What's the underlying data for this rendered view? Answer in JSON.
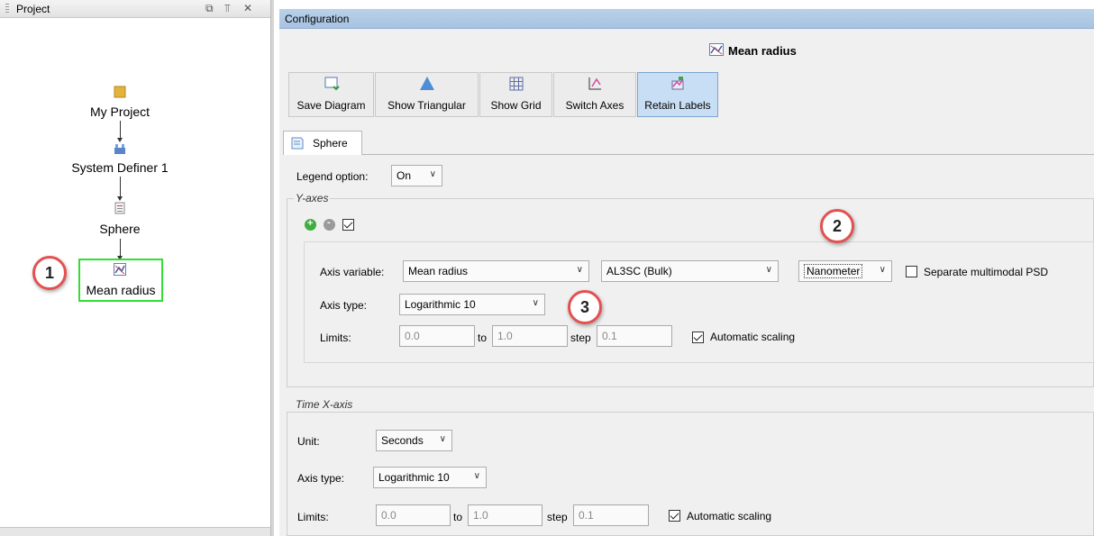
{
  "project": {
    "title": "Project",
    "nodes": [
      {
        "label": "My Project",
        "icon": "folder-icon"
      },
      {
        "label": "System Definer 1",
        "icon": "system-definer-icon"
      },
      {
        "label": "Sphere",
        "icon": "sphere-icon"
      },
      {
        "label": "Mean radius",
        "icon": "chart-icon"
      }
    ]
  },
  "badges": {
    "one": "1",
    "two": "2",
    "three": "3"
  },
  "configuration": {
    "title": "Configuration",
    "diagram_title": "Mean radius",
    "toolbar": [
      {
        "label": "Save Diagram",
        "icon": "save-diagram-icon"
      },
      {
        "label": "Show Triangular",
        "icon": "triangle-icon"
      },
      {
        "label": "Show Grid",
        "icon": "grid-icon"
      },
      {
        "label": "Switch Axes",
        "icon": "switch-axes-icon"
      },
      {
        "label": "Retain Labels",
        "icon": "retain-labels-icon"
      }
    ],
    "tab": "Sphere",
    "legend": {
      "label": "Legend option:",
      "value": "On"
    },
    "y_axes": {
      "title": "Y-axes",
      "axis_variable_label": "Axis variable:",
      "axis_variable": "Mean radius",
      "source": "AL3SC (Bulk)",
      "unit": "Nanometer",
      "separate_label": "Separate multimodal PSD",
      "axis_type_label": "Axis type:",
      "axis_type": "Logarithmic 10",
      "limits_label": "Limits:",
      "limit_from": "0.0",
      "to_label": "to",
      "limit_to": "1.0",
      "step_label": "step",
      "step": "0.1",
      "auto_scaling_label": "Automatic scaling"
    },
    "time_x_axis": {
      "title": "Time X-axis",
      "unit_label": "Unit:",
      "unit": "Seconds",
      "axis_type_label": "Axis type:",
      "axis_type": "Logarithmic 10",
      "limits_label": "Limits:",
      "limit_from": "0.0",
      "to_label": "to",
      "limit_to": "1.0",
      "step_label": "step",
      "step": "0.1",
      "auto_scaling_label": "Automatic scaling"
    }
  },
  "colors": {
    "selection_border": "#33dd33",
    "badge_border": "#e45050",
    "header_blue": "#b9d1ea",
    "active_button": "#c8def4"
  }
}
